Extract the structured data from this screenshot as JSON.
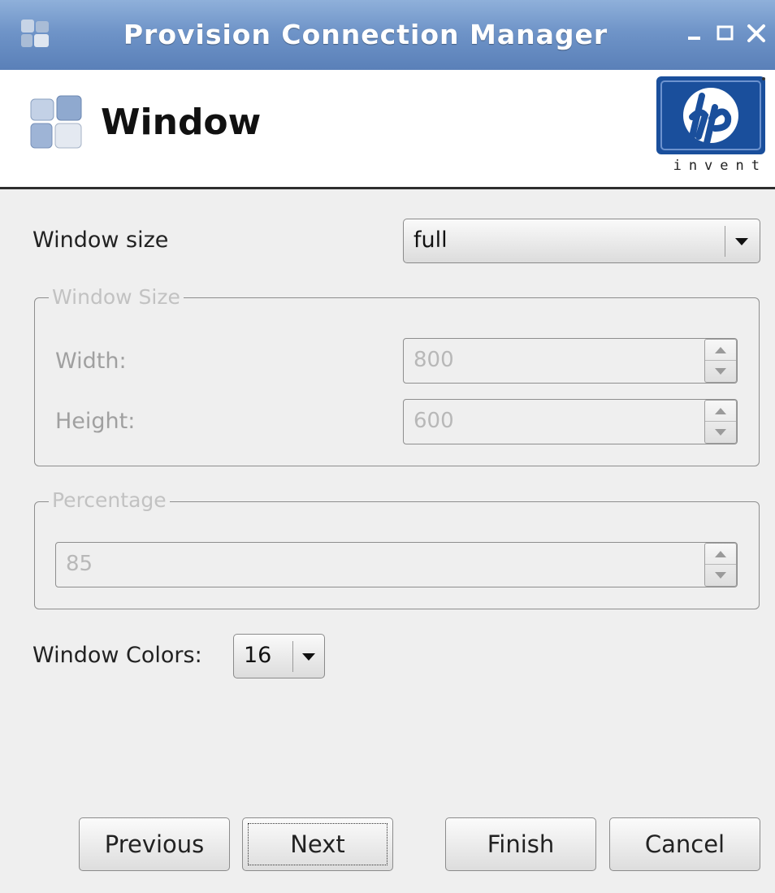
{
  "window": {
    "title": "Provision Connection Manager"
  },
  "header": {
    "title": "Window",
    "logo_text": "invent"
  },
  "window_size": {
    "label": "Window size",
    "selected": "full"
  },
  "size_group": {
    "legend": "Window Size",
    "width_label": "Width:",
    "width_value": "800",
    "height_label": "Height:",
    "height_value": "600"
  },
  "percentage_group": {
    "legend": "Percentage",
    "value": "85"
  },
  "colors": {
    "label": "Window Colors:",
    "selected": "16"
  },
  "buttons": {
    "previous": "Previous",
    "next": "Next",
    "finish": "Finish",
    "cancel": "Cancel"
  },
  "theme": {
    "titlebar": "#6f94c8",
    "hp_blue": "#1a4f9c",
    "disabled_text": "#b8b8b8"
  }
}
